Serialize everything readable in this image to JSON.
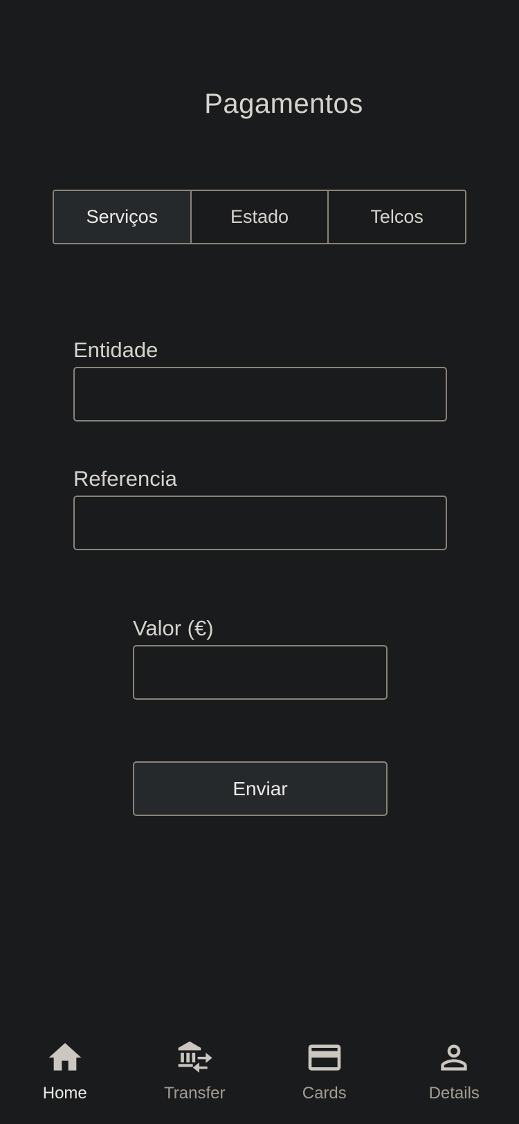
{
  "header": {
    "title": "Pagamentos"
  },
  "tabs": [
    {
      "label": "Serviços",
      "active": true
    },
    {
      "label": "Estado",
      "active": false
    },
    {
      "label": "Telcos",
      "active": false
    }
  ],
  "form": {
    "entidade": {
      "label": "Entidade",
      "value": ""
    },
    "referencia": {
      "label": "Referencia",
      "value": ""
    },
    "valor": {
      "label": "Valor (€)",
      "value": ""
    },
    "submit_label": "Enviar"
  },
  "bottom_nav": {
    "items": [
      {
        "label": "Home",
        "icon": "home-icon",
        "active": true
      },
      {
        "label": "Transfer",
        "icon": "bank-transfer-icon",
        "active": false
      },
      {
        "label": "Cards",
        "icon": "credit-card-icon",
        "active": false
      },
      {
        "label": "Details",
        "icon": "person-icon",
        "active": false
      }
    ]
  },
  "colors": {
    "background": "#1a1b1d",
    "border": "#8a8378",
    "active_fill": "#25292b",
    "text": "#d6d3cd"
  }
}
